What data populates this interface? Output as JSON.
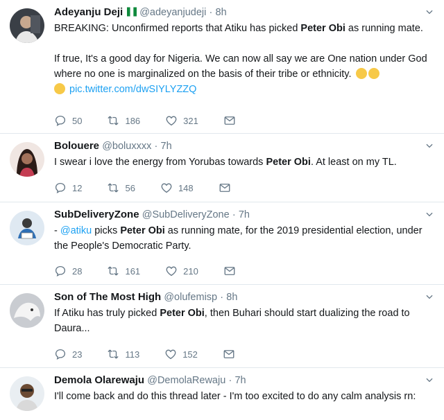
{
  "tweets": [
    {
      "name": "Adeyanju Deji",
      "handle": "@adeyanjudeji",
      "time": "8h",
      "has_flag": true,
      "text1_pre": "BREAKING: Unconfirmed reports that Atiku has picked ",
      "text1_bold": "Peter Obi",
      "text1_post": " as running mate.",
      "text2": "If true, It's a good day for Nigeria. We can now all say we are One nation under God where no one is marginalized on the basis of their tribe or ethnicity.",
      "link": "pic.twitter.com/dwSIYLYZZQ",
      "replies": "50",
      "retweets": "186",
      "likes": "321"
    },
    {
      "name": "Bolouere",
      "handle": "@boluxxxx",
      "time": "7h",
      "text_pre": "I swear i love the energy from Yorubas towards ",
      "text_bold": "Peter Obi",
      "text_post": ". At least on my TL.",
      "replies": "12",
      "retweets": "56",
      "likes": "148"
    },
    {
      "name": "SubDeliveryZone",
      "handle": "@SubDeliveryZone",
      "time": "7h",
      "text_lead": "- ",
      "mention": "@atiku",
      "text_pre": " picks ",
      "text_bold": "Peter Obi",
      "text_post": " as running mate, for the 2019 presidential election, under the People's Democratic Party.",
      "replies": "28",
      "retweets": "161",
      "likes": "210"
    },
    {
      "name": "Son of The Most High",
      "handle": "@olufemisp",
      "time": "8h",
      "text_pre": "If Atiku has truly picked ",
      "text_bold": "Peter Obi",
      "text_post": ", then Buhari should start dualizing the road to Daura...",
      "replies": "23",
      "retweets": "113",
      "likes": "152"
    },
    {
      "name": "Demola Olarewaju",
      "handle": "@DemolaRewaju",
      "time": "7h",
      "text": "I'll come back and do this thread later - I'm too excited to do any calm analysis rn:"
    }
  ],
  "separator": "·",
  "icons": {
    "reply": "reply-icon",
    "retweet": "retweet-icon",
    "like": "heart-icon",
    "dm": "envelope-icon",
    "more": "chevron-down-icon"
  },
  "colors": {
    "link": "#1da1f2",
    "muted": "#657786",
    "divider": "#e1e8ed"
  }
}
